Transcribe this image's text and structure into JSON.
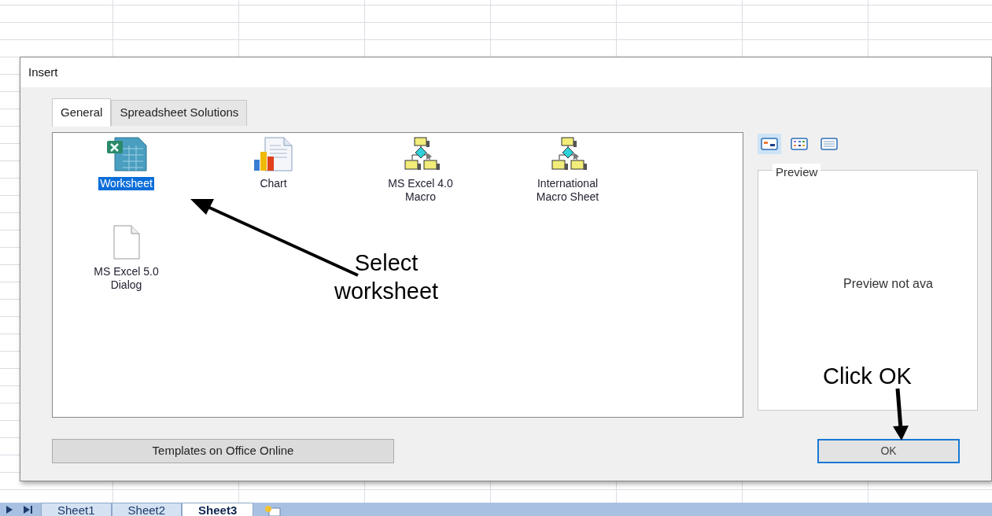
{
  "window": {
    "title": "Insert"
  },
  "tabs": [
    {
      "label": "General",
      "selected": true
    },
    {
      "label": "Spreadsheet Solutions",
      "selected": false
    }
  ],
  "items": [
    {
      "label": "Worksheet",
      "kind": "worksheet",
      "selected": true
    },
    {
      "label": "Chart",
      "kind": "chart",
      "selected": false
    },
    {
      "label": "MS Excel 4.0\nMacro",
      "kind": "macro",
      "selected": false
    },
    {
      "label": "International\nMacro Sheet",
      "kind": "macro",
      "selected": false
    },
    {
      "label": "MS Excel 5.0\nDialog",
      "kind": "dialog",
      "selected": false
    }
  ],
  "view_buttons": [
    {
      "kind": "large-icons",
      "selected": true
    },
    {
      "kind": "list",
      "selected": false
    },
    {
      "kind": "details",
      "selected": false
    }
  ],
  "preview": {
    "title": "Preview",
    "message": "Preview not ava"
  },
  "buttons": {
    "templates": "Templates on Office Online",
    "ok": "OK"
  },
  "sheet_tabs": [
    {
      "label": "Sheet1",
      "selected": false
    },
    {
      "label": "Sheet2",
      "selected": false
    },
    {
      "label": "Sheet3",
      "selected": true
    }
  ],
  "annotations": [
    {
      "text": "Select\nworksheet",
      "kind": "select"
    },
    {
      "text": "Click OK",
      "kind": "ok"
    }
  ]
}
